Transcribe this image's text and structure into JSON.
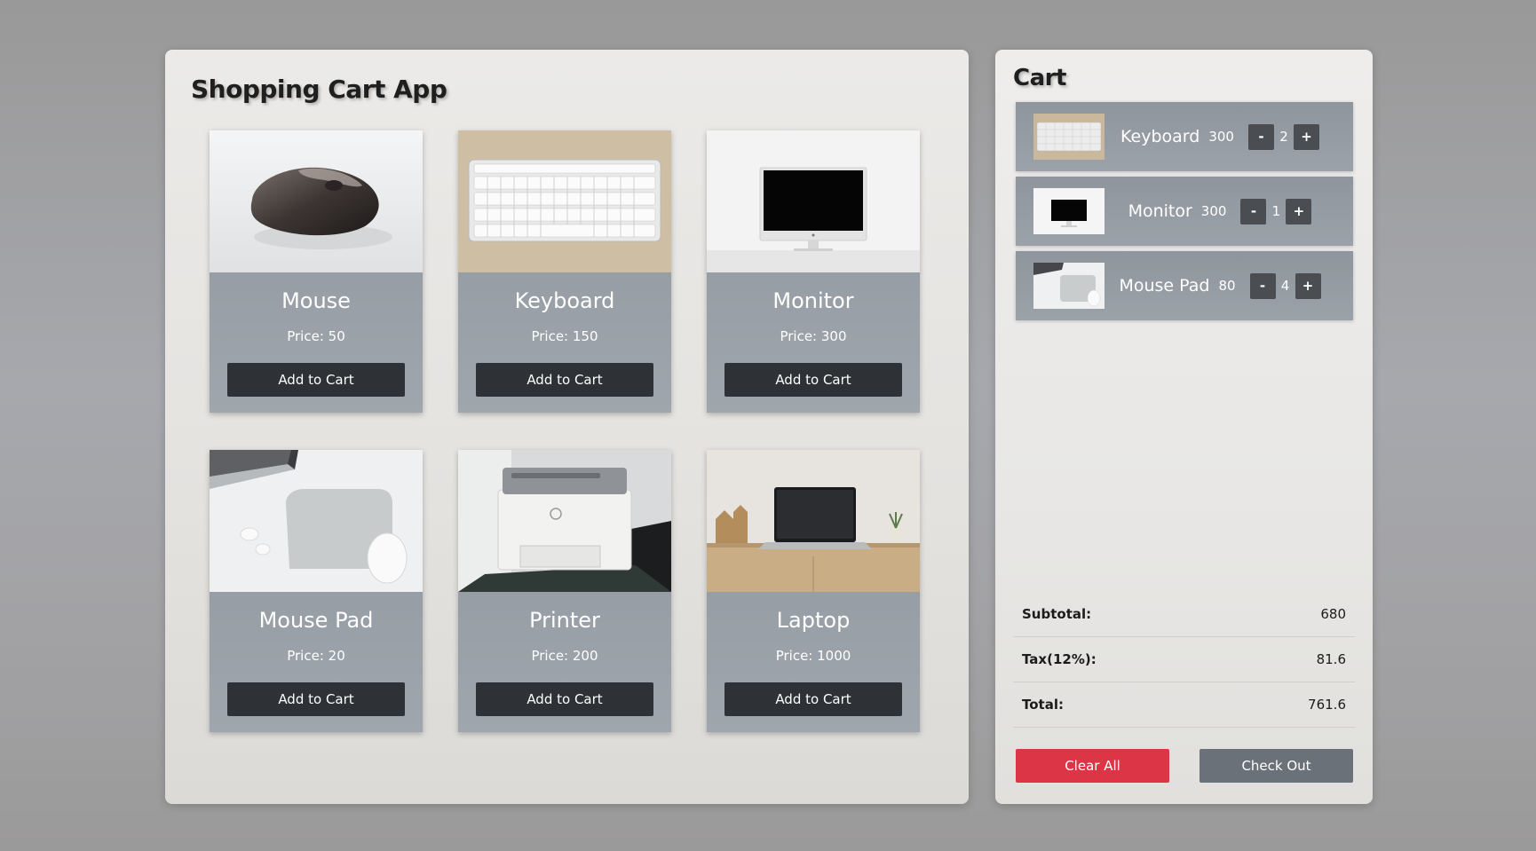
{
  "shop": {
    "title": "Shopping Cart App",
    "products": [
      {
        "name": "Mouse",
        "price_text": "Price: 50",
        "button": "Add to Cart"
      },
      {
        "name": "Keyboard",
        "price_text": "Price: 150",
        "button": "Add to Cart"
      },
      {
        "name": "Monitor",
        "price_text": "Price: 300",
        "button": "Add to Cart"
      },
      {
        "name": "Mouse Pad",
        "price_text": "Price: 20",
        "button": "Add to Cart"
      },
      {
        "name": "Printer",
        "price_text": "Price: 200",
        "button": "Add to Cart"
      },
      {
        "name": "Laptop",
        "price_text": "Price: 1000",
        "button": "Add to Cart"
      }
    ]
  },
  "cart": {
    "title": "Cart",
    "items": [
      {
        "name": "Keyboard",
        "total": "300",
        "qty": "2",
        "minus": "-",
        "plus": "+"
      },
      {
        "name": "Monitor",
        "total": "300",
        "qty": "1",
        "minus": "-",
        "plus": "+"
      },
      {
        "name": "Mouse Pad",
        "total": "80",
        "qty": "4",
        "minus": "-",
        "plus": "+"
      }
    ],
    "summary": {
      "subtotal_label": "Subtotal:",
      "subtotal": "680",
      "tax_label": "Tax(12%):",
      "tax": "81.6",
      "total_label": "Total:",
      "total": "761.6"
    },
    "clear_label": "Clear All",
    "checkout_label": "Check Out"
  },
  "colors": {
    "card_bg": "#959ba2",
    "button_dark": "#2e3236",
    "clear_button": "#dc3545",
    "checkout_button": "#6b7179"
  }
}
